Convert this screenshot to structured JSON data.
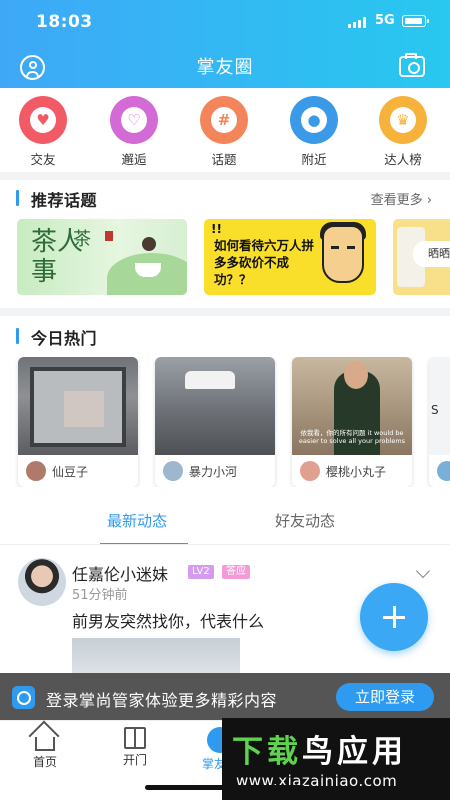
{
  "status_bar": {
    "time": "18:03",
    "network": "5G"
  },
  "header": {
    "title": "掌友圈"
  },
  "categories": [
    {
      "label": "交友",
      "icon": "heart-icon",
      "color": "#f25a66",
      "glyph": "♥"
    },
    {
      "label": "邂逅",
      "icon": "pulse-heart-icon",
      "color": "#d46ad6",
      "glyph": "♡"
    },
    {
      "label": "话题",
      "icon": "hashtag-icon",
      "color": "#f4855b",
      "glyph": "#"
    },
    {
      "label": "附近",
      "icon": "location-pin-icon",
      "color": "#3a9ae8",
      "glyph": "●"
    },
    {
      "label": "达人榜",
      "icon": "crown-icon",
      "color": "#f6b23b",
      "glyph": "♛"
    }
  ],
  "recommended": {
    "title": "推荐话题",
    "more": "查看更多",
    "topics": [
      {
        "text": "茶人事",
        "sub": "茶"
      },
      {
        "text": "如何看待六万人拼多多砍价不成功？？",
        "excl": "!!"
      },
      {
        "text": "晒晒"
      }
    ]
  },
  "hot_today": {
    "title": "今日热门",
    "cards": [
      {
        "user": "仙豆子",
        "avatar_color": "#b07a6a"
      },
      {
        "user": "暴力小河",
        "avatar_color": "#9fb6cf"
      },
      {
        "user": "樱桃小丸子",
        "avatar_color": "#e0a090",
        "subtitle": "依我看，你的所有问题 it would be easier to solve all your problems"
      },
      {
        "user": "",
        "avatar_color": "#7ab0d8",
        "snippet": "S"
      }
    ]
  },
  "tabs": {
    "latest": "最新动态",
    "friends": "好友动态"
  },
  "post": {
    "author": "任嘉伦小迷妹",
    "level": "LV2",
    "tag": "答应",
    "time": "51分钟前",
    "text": "前男友突然找你，代表什么"
  },
  "login_banner": {
    "text": "登录掌尚管家体验更多精彩内容",
    "button": "立即登录"
  },
  "bottom_nav": [
    {
      "label": "首页"
    },
    {
      "label": "开门"
    },
    {
      "label": "掌友圈"
    }
  ],
  "watermark": {
    "title_green": "下载",
    "title_white": "鸟应用",
    "url": "www.xiazainiao.com"
  },
  "colors": {
    "accent": "#2f9bf0",
    "header_start": "#3ea8f7",
    "header_end": "#28c8ef"
  }
}
